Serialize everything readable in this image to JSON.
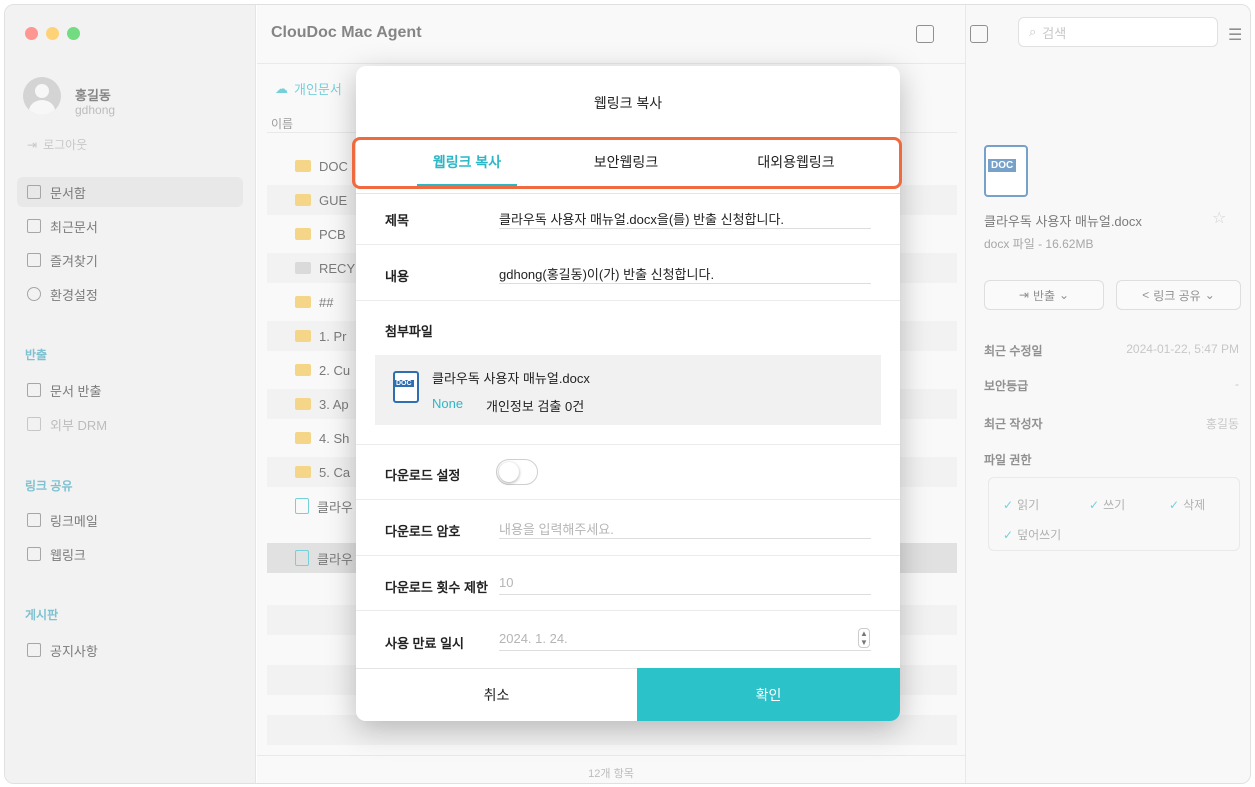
{
  "app": {
    "title": "ClouDoc Mac Agent"
  },
  "profile": {
    "name": "홍길동",
    "id": "gdhong",
    "logout": "로그아웃"
  },
  "sidebar": {
    "items": [
      {
        "label": "문서함",
        "icon": "inbox-icon"
      },
      {
        "label": "최근문서",
        "icon": "recent-docs-icon"
      },
      {
        "label": "즐겨찾기",
        "icon": "favorites-icon"
      },
      {
        "label": "환경설정",
        "icon": "settings-icon"
      }
    ],
    "export_head": "반출",
    "export_items": [
      {
        "label": "문서 반출",
        "icon": "export-icon"
      },
      {
        "label": "외부 DRM",
        "icon": "external-drm-icon"
      }
    ],
    "link_head": "링크 공유",
    "link_items": [
      {
        "label": "링크메일",
        "icon": "link-mail-icon"
      },
      {
        "label": "웹링크",
        "icon": "weblink-icon"
      }
    ],
    "board_head": "게시판",
    "board_items": [
      {
        "label": "공지사항",
        "icon": "megaphone-icon"
      }
    ]
  },
  "center": {
    "breadcrumb": "개인문서",
    "column_name": "이름",
    "rows": [
      "DOC",
      "GUE",
      "PCB",
      "RECY",
      "##",
      "1. Pr",
      "2. Cu",
      "3. Ap",
      "4. Sh",
      "5. Ca",
      "클라우",
      "클라우"
    ],
    "status": "12개 항목"
  },
  "search": {
    "placeholder": "검색"
  },
  "detail": {
    "doc_badge": "DOC",
    "file_name": "클라우독 사용자 매뉴얼.docx",
    "file_meta": "docx 파일 - 16.62MB",
    "export_btn": "반출",
    "share_btn": "링크 공유",
    "modified_label": "최근 수정일",
    "modified_value": "2024-01-22, 5:47 PM",
    "security_label": "보안등급",
    "security_value": "-",
    "author_label": "최근 작성자",
    "author_value": "홍길동",
    "perm_label": "파일 권한",
    "perms": [
      "읽기",
      "쓰기",
      "삭제",
      "덮어쓰기"
    ]
  },
  "modal": {
    "title": "웹링크 복사",
    "tabs": [
      "웹링크 복사",
      "보안웹링크",
      "대외용웹링크"
    ],
    "subject_label": "제목",
    "subject_value": "클라우독 사용자 매뉴얼.docx을(를) 반출 신청합니다.",
    "content_label": "내용",
    "content_value": "gdhong(홍길동)이(가) 반출 신청합니다.",
    "attach_label": "첨부파일",
    "attach_badge": "DOC",
    "attach_name": "클라우독 사용자 매뉴얼.docx",
    "attach_status": "None",
    "attach_pii": "개인정보 검출 0건",
    "download_setting_label": "다운로드 설정",
    "download_setting_on": false,
    "download_pw_label": "다운로드 암호",
    "download_pw_placeholder": "내용을 입력해주세요.",
    "download_limit_label": "다운로드 횟수 제한",
    "download_limit_placeholder": "10",
    "expire_label": "사용 만료 일시",
    "expire_value": "2024.  1. 24.",
    "cancel": "취소",
    "confirm": "확인"
  },
  "colors": {
    "accent": "#2bc3c9",
    "highlight": "#f06a3f",
    "folder": "#f0c14a"
  }
}
